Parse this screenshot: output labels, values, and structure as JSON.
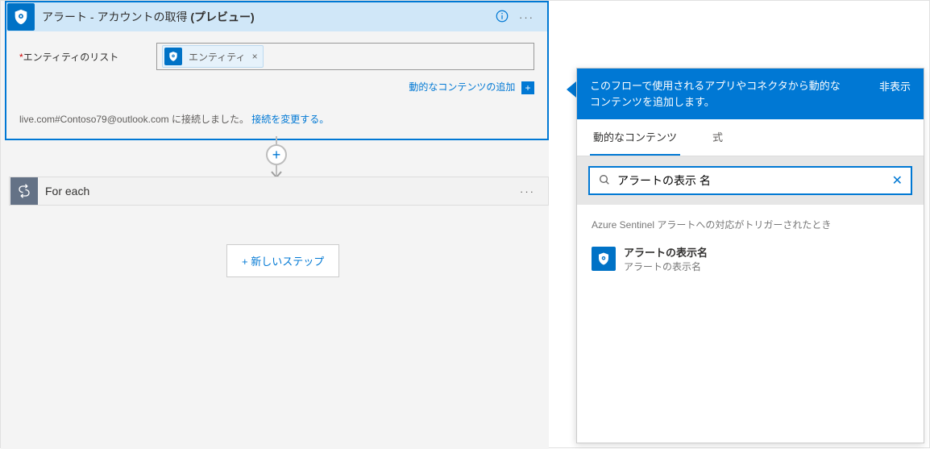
{
  "alert_card": {
    "title_plain": "アラート - アカウントの取得 ",
    "title_bold": "(プレビュー)",
    "field_label": "エンティティのリスト",
    "token_label": "エンティティ",
    "dynamic_content_link": "動的なコンテンツの追加",
    "connection_text_prefix": "live.com#Contoso79@outlook.com に接続しました。",
    "connection_change_link": "接続を変更する。"
  },
  "foreach_card": {
    "title": "For each"
  },
  "new_step_button": "+ 新しいステップ",
  "panel": {
    "header_msg": "このフローで使用されるアプリやコネクタから動的なコンテンツを追加します。",
    "hide_label": "非表示",
    "tabs": {
      "dynamic": "動的なコンテンツ",
      "expression": "式"
    },
    "search_value": "アラートの表示 名",
    "section_title": "Azure Sentinel アラートへの対応がトリガーされたとき",
    "result": {
      "title": "アラートの表示名",
      "subtitle": "アラートの表示名"
    }
  }
}
